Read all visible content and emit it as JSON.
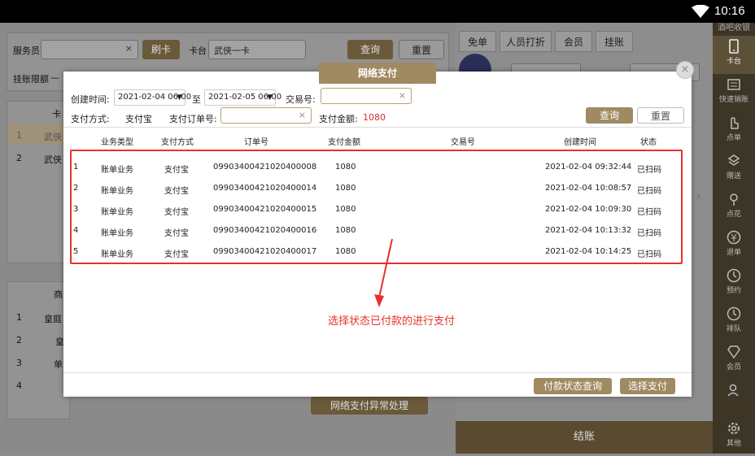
{
  "status": {
    "time": "10:16"
  },
  "background": {
    "waiter_label": "服务员",
    "swipe_card_label": "刷卡",
    "table_label": "卡台",
    "table_value": "武侠一卡",
    "query_label": "查询",
    "reset_label": "重置",
    "hang_limit_label": "挂账限额",
    "hang_limit_value": "—",
    "list_header_left": "卡",
    "list_rows": [
      {
        "no": "1",
        "name": "武侠"
      },
      {
        "no": "2",
        "name": "武侠"
      }
    ],
    "product_header": "商",
    "product_rows": [
      {
        "no": "1",
        "name": "皇庭"
      },
      {
        "no": "2",
        "name": "皇"
      },
      {
        "no": "3",
        "name": "单"
      },
      {
        "no": "4",
        "name": ""
      }
    ],
    "payment_exception_label": "网络支付异常处理",
    "right_tabs": [
      "免单",
      "人员打折",
      "会员",
      "挂账"
    ],
    "settle_label": "结账"
  },
  "sidebar": {
    "brand": "酒吧收银",
    "items": [
      {
        "label": "卡台",
        "icon": "tablet-icon",
        "active": true
      },
      {
        "label": "快速销账",
        "icon": "list-icon",
        "active": false
      },
      {
        "label": "点单",
        "icon": "hand-icon",
        "active": false
      },
      {
        "label": "赠送",
        "icon": "gift-icon",
        "active": false
      },
      {
        "label": "点花",
        "icon": "flower-icon",
        "active": false
      },
      {
        "label": "退单",
        "icon": "yen-icon",
        "active": false
      },
      {
        "label": "预约",
        "icon": "clock-icon",
        "active": false
      },
      {
        "label": "排队",
        "icon": "clock-icon",
        "active": false
      },
      {
        "label": "会员",
        "icon": "diamond-icon",
        "active": false
      },
      {
        "label": "",
        "icon": "user-icon",
        "active": false
      },
      {
        "label": "其他",
        "icon": "gear-icon",
        "active": false
      }
    ]
  },
  "dialog": {
    "title": "网络支付",
    "filters": {
      "created_time_label": "创建时间:",
      "start_date": "2021-02-04 06:00",
      "to_label": "至",
      "end_date": "2021-02-05 06:00",
      "transaction_no_label": "交易号:",
      "transaction_no_value": "",
      "pay_method_label": "支付方式:",
      "pay_method_value": "支付宝",
      "pay_order_label": "支付订单号:",
      "pay_order_value": "",
      "pay_amount_label": "支付金额:",
      "pay_amount_value": "1080",
      "query_label": "查询",
      "reset_label": "重置"
    },
    "table": {
      "headers": [
        "业务类型",
        "支付方式",
        "订单号",
        "支付金额",
        "交易号",
        "创建时间",
        "状态"
      ],
      "rows": [
        {
          "no": "1",
          "type": "账单业务",
          "method": "支付宝",
          "order": "09903400421020400008",
          "amount": "1080",
          "txn": "",
          "created": "2021-02-04 09:32:44",
          "status": "已扫码"
        },
        {
          "no": "2",
          "type": "账单业务",
          "method": "支付宝",
          "order": "09903400421020400014",
          "amount": "1080",
          "txn": "",
          "created": "2021-02-04 10:08:57",
          "status": "已扫码"
        },
        {
          "no": "3",
          "type": "账单业务",
          "method": "支付宝",
          "order": "09903400421020400015",
          "amount": "1080",
          "txn": "",
          "created": "2021-02-04 10:09:30",
          "status": "已扫码"
        },
        {
          "no": "4",
          "type": "账单业务",
          "method": "支付宝",
          "order": "09903400421020400016",
          "amount": "1080",
          "txn": "",
          "created": "2021-02-04 10:13:32",
          "status": "已扫码"
        },
        {
          "no": "5",
          "type": "账单业务",
          "method": "支付宝",
          "order": "09903400421020400017",
          "amount": "1080",
          "txn": "",
          "created": "2021-02-04 10:14:25",
          "status": "已扫码"
        }
      ]
    },
    "footer": {
      "status_query_label": "付款状态查询",
      "select_pay_label": "选择支付"
    }
  },
  "annotation": {
    "text": "选择状态已付款的进行支付",
    "color": "#e6312e"
  },
  "colors": {
    "accent": "#a08a62",
    "sidebar": "#3d3526",
    "highlight": "#e6312e"
  }
}
